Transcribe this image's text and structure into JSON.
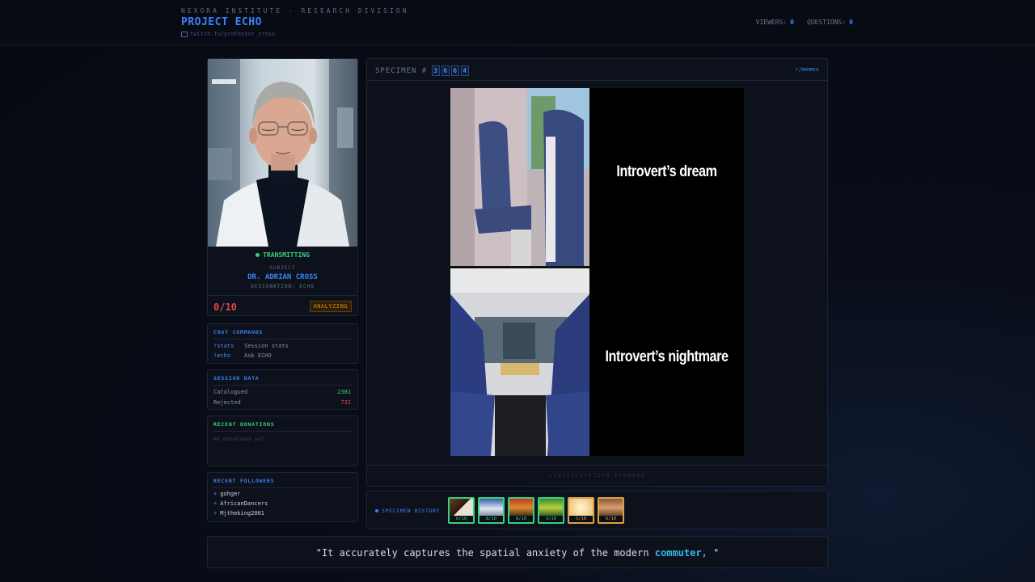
{
  "header": {
    "org": "NEXORA INSTITUTE - RESEARCH DIVISION",
    "project": "PROJECT ECHO",
    "channel": "twitch.tv/professor_cross",
    "viewers_label": "VIEWERS:",
    "viewers": "0",
    "questions_label": "QUESTIONS:",
    "questions": "0"
  },
  "subject": {
    "status": "TRANSMITTING",
    "label": "SUBJECT",
    "name": "DR. ADRIAN CROSS",
    "designation": "DESIGNATION: ECHO",
    "score": "0/10",
    "state": "ANALYZING"
  },
  "commands": {
    "title": "CHAT COMMANDS",
    "items": [
      {
        "cmd": "!stats",
        "desc": "Session stats"
      },
      {
        "cmd": "!echo",
        "desc": "Ask ECHO"
      }
    ]
  },
  "session": {
    "title": "SESSION DATA",
    "catalogued_label": "Catalogued",
    "catalogued": "2381",
    "rejected_label": "Rejected",
    "rejected": "732"
  },
  "donations": {
    "title": "RECENT DONATIONS",
    "empty": "No donations yet"
  },
  "followers": {
    "title": "RECENT FOLLOWERS",
    "items": [
      "gohger",
      "AfricanDancers",
      "Mjtheking2001"
    ]
  },
  "specimen": {
    "label": "SPECIMEN #",
    "digits": [
      "3",
      "6",
      "6",
      "4"
    ],
    "source": "r/memes",
    "top_caption": "Introvert’s dream",
    "bottom_caption": "Introvert’s nightmare",
    "classification": "CLASSIFICATION PENDING"
  },
  "history": {
    "label": "SPECIMEN HISTORY",
    "items": [
      {
        "score": "8/10",
        "border": "#35d07f",
        "text_color": "#35d07f"
      },
      {
        "score": "8/10",
        "border": "#35d07f",
        "text_color": "#35d07f"
      },
      {
        "score": "8/10",
        "border": "#35d07f",
        "text_color": "#35d07f"
      },
      {
        "score": "9/10",
        "border": "#35d07f",
        "text_color": "#35d07f"
      },
      {
        "score": "5/10",
        "border": "#e0a040",
        "text_color": "#e0a040"
      },
      {
        "score": "6/10",
        "border": "#e0a040",
        "text_color": "#e0a040"
      }
    ]
  },
  "quote": {
    "text": "\"It accurately captures the spatial anxiety of the modern ",
    "highlight": "commuter,",
    "end": " \""
  },
  "colors": {
    "accent": "#3b82f6",
    "success": "#35d07f",
    "danger": "#e0444f",
    "warning": "#d4891e"
  }
}
